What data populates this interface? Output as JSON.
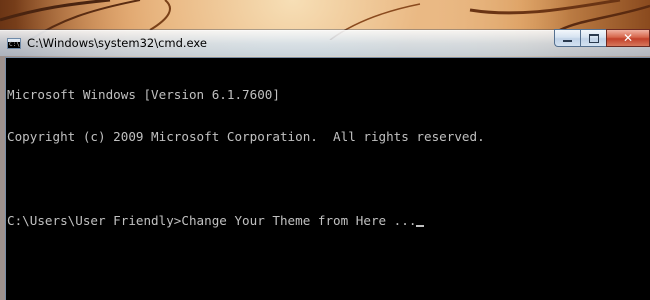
{
  "window": {
    "title": "C:\\Windows\\system32\\cmd.exe",
    "app_icon": "cmd-icon",
    "app_icon_prompt": "C:\\",
    "caption_buttons": {
      "minimize_icon": "minimize-icon",
      "maximize_icon": "maximize-icon",
      "close_icon": "close-icon",
      "close_glyph": "✕"
    }
  },
  "console": {
    "lines": [
      "Microsoft Windows [Version 6.1.7600]",
      "Copyright (c) 2009 Microsoft Corporation.  All rights reserved.",
      "",
      "C:\\Users\\User Friendly>Change Your Theme from Here ..."
    ],
    "text_color": "#c0c0c0",
    "background_color": "#000000"
  },
  "colors": {
    "close_button": "#c2412a",
    "titlebar_tint": "#c8def2"
  }
}
